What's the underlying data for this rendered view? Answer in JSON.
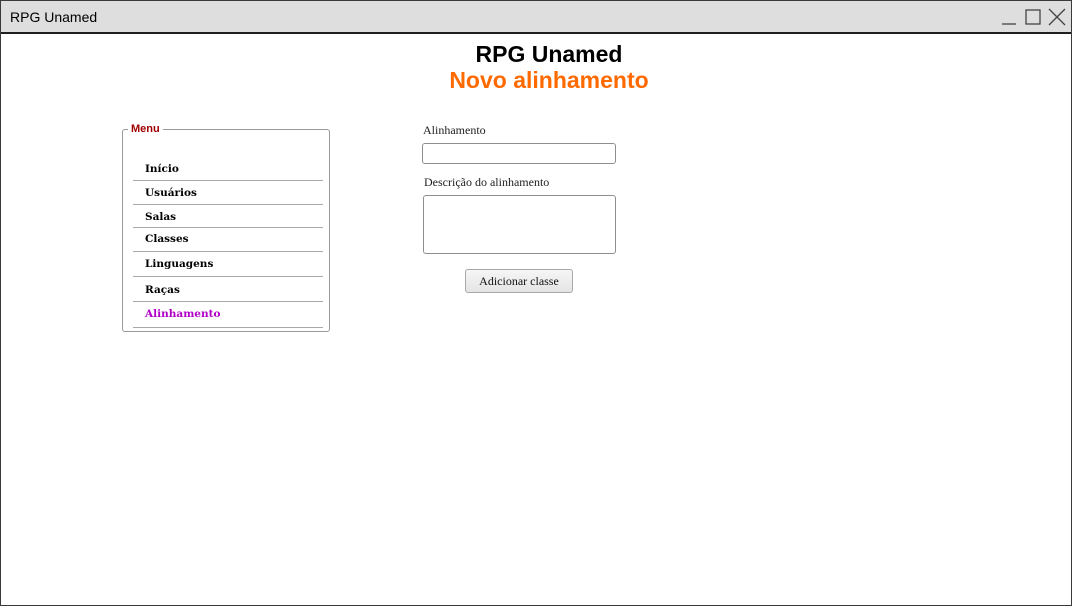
{
  "window": {
    "title": "RPG Unamed",
    "controls": [
      "minimize-icon",
      "maximize-icon",
      "close-icon"
    ]
  },
  "header": {
    "app_name": "RPG Unamed",
    "page_title": "Novo alinhamento",
    "page_title_color": "#ff6a00"
  },
  "menu": {
    "legend": "Menu",
    "legend_color": "#a00000",
    "active_color": "#b000c8",
    "items": [
      {
        "label": "Início"
      },
      {
        "label": "Usuários"
      },
      {
        "label": "Salas"
      },
      {
        "label": "Classes"
      },
      {
        "label": "Linguagens"
      },
      {
        "label": "Raças"
      },
      {
        "label": "Alinhamento",
        "active": true
      }
    ]
  },
  "form": {
    "alinhamento_label": "Alinhamento",
    "alinhamento_value": "",
    "descricao_label": "Descrição do alinhamento",
    "descricao_value": "",
    "submit_label": "Adicionar classe"
  }
}
